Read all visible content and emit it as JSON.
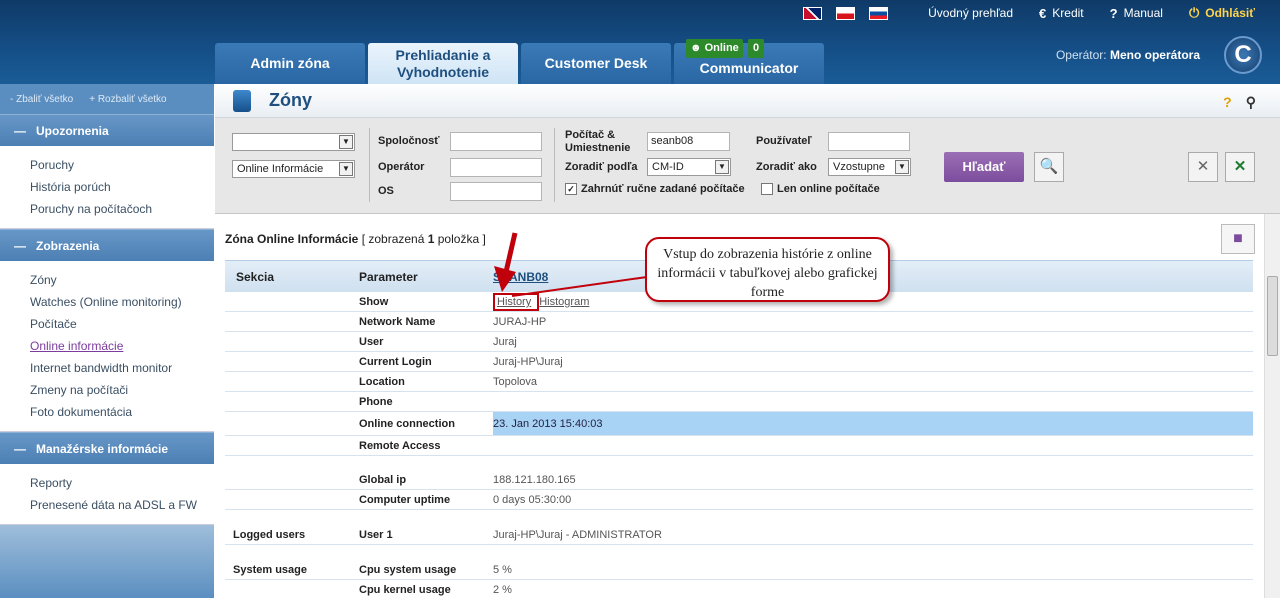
{
  "header": {
    "nav": {
      "home": "Úvodný prehľad",
      "credit": "Kredit",
      "manual": "Manual",
      "logout": "Odhlásiť"
    },
    "tabs": [
      {
        "label": "Admin zóna"
      },
      {
        "label": "Prehliadanie a Vyhodnotenie"
      },
      {
        "label": "Customer Desk"
      },
      {
        "label": "Communicator"
      }
    ],
    "online": {
      "label": "Online",
      "count": "0"
    },
    "operator": {
      "label": "Operátor:",
      "name": "Meno operátora"
    },
    "logo": "C"
  },
  "sidebar": {
    "collapse_all": "- Zbaliť všetko",
    "expand_all": "+ Rozbaliť všetko",
    "sections": [
      {
        "title": "Upozornenia",
        "items": [
          "Poruchy",
          "História porúch",
          "Poruchy na počítačoch"
        ]
      },
      {
        "title": "Zobrazenia",
        "items": [
          "Zóny",
          "Watches (Online monitoring)",
          "Počítače",
          "Online informácie",
          "Internet bandwidth monitor",
          "Zmeny na počítači",
          "Foto dokumentácia"
        ]
      },
      {
        "title": "Manažérske informácie",
        "items": [
          "Reporty",
          "Prenesené dáta na ADSL a FW"
        ]
      }
    ]
  },
  "page": {
    "title": "Zóny",
    "help": "?"
  },
  "filters": {
    "select1": "",
    "select2": "Online Informácie",
    "spolocnost": "Spoločnosť",
    "operator": "Operátor",
    "os": "OS",
    "pocitac": "Počítač & Umiestnenie",
    "pocitac_value": "seanb08",
    "zoradit_podla": "Zoradiť podľa",
    "zoradit_value": "CM-ID",
    "zahrnut": "Zahrnúť ručne zadané počítače",
    "len_online": "Len online počítače",
    "pouzivatel": "Používateľ",
    "zoradit_ako": "Zoradiť ako",
    "zoradit_ako_value": "Vzostupne",
    "search_btn": "Hľadať"
  },
  "zone": {
    "title_a": "Zóna Online Informácie",
    "title_b": " [ zobrazená ",
    "count": "1",
    "title_c": " položka ]"
  },
  "table": {
    "headers": [
      "Sekcia",
      "Parameter",
      "SEANB08"
    ],
    "history": "History",
    "histogram": "Histogram",
    "rows": [
      {
        "s": "",
        "p": "Network Name",
        "v": "JURAJ-HP"
      },
      {
        "s": "",
        "p": "User",
        "v": "Juraj"
      },
      {
        "s": "",
        "p": "Current Login",
        "v": "Juraj-HP\\Juraj"
      },
      {
        "s": "",
        "p": "Location",
        "v": "Topolova"
      },
      {
        "s": "",
        "p": "Phone",
        "v": ""
      },
      {
        "s": "",
        "p": "Online connection",
        "v": "23. Jan 2013 15:40:03"
      },
      {
        "s": "",
        "p": "Remote Access",
        "v": ""
      },
      {
        "s": "",
        "p": "Global ip",
        "v": "188.121.180.165"
      },
      {
        "s": "",
        "p": "Computer uptime",
        "v": "0 days 05:30:00"
      },
      {
        "s": "Logged users",
        "p": "User 1",
        "v": "Juraj-HP\\Juraj - ADMINISTRATOR"
      },
      {
        "s": "System usage",
        "p": "Cpu system usage",
        "v": "5 %"
      },
      {
        "s": "",
        "p": "Cpu kernel usage",
        "v": "2 %"
      }
    ],
    "show_label": "Show"
  },
  "callout": "Vstup do zobrazenia histórie z online informácii v tabuľkovej alebo grafickej forme"
}
